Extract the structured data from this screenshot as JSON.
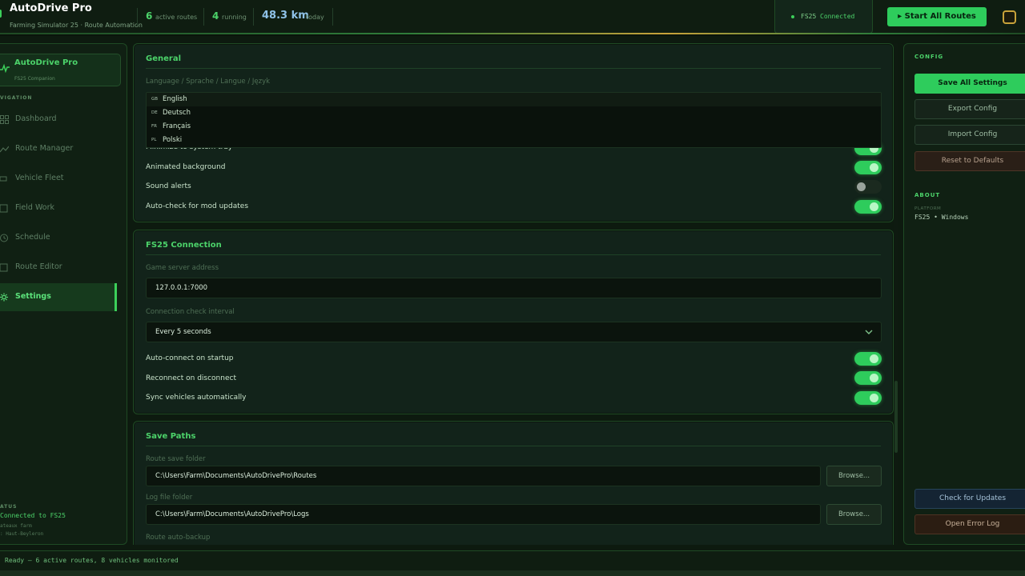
{
  "header": {
    "title": "AutoDrive Pro",
    "subtitle": "Farming Simulator 25 · Route Automation",
    "stats": [
      {
        "value": "6",
        "label": "active routes"
      },
      {
        "value": "4",
        "label": "running"
      },
      {
        "value": "48.3 km",
        "label": "today"
      }
    ],
    "connection": {
      "game": "FS25",
      "status": "Connected"
    },
    "start_button": "▸ Start All Routes"
  },
  "sidebar": {
    "brand_title": "AutoDrive Pro",
    "brand_subtitle": "FS25 Companion",
    "nav_heading": "VIGATION",
    "items": [
      {
        "label": "Dashboard",
        "icon": "grid-icon"
      },
      {
        "label": "Route Manager",
        "icon": "route-icon"
      },
      {
        "label": "Vehicle Fleet",
        "icon": "vehicle-icon"
      },
      {
        "label": "Field Work",
        "icon": "field-icon"
      },
      {
        "label": "Schedule",
        "icon": "clock-icon"
      },
      {
        "label": "Route Editor",
        "icon": "editor-icon"
      },
      {
        "label": "Settings",
        "icon": "gear-icon",
        "active": true
      }
    ],
    "status_heading": "ATUS",
    "status_connected": "Connected to FS25",
    "status_farm": "ateaux farm",
    "status_map": ": Haut-Beyleron"
  },
  "general": {
    "title": "General",
    "language_label": "Language / Sprache / Langue / Język",
    "language_options": [
      {
        "code": "GB",
        "name": "English"
      },
      {
        "code": "DE",
        "name": "Deutsch"
      },
      {
        "code": "FR",
        "name": "Français"
      },
      {
        "code": "PL",
        "name": "Polski"
      }
    ],
    "partial_row": "Minimize to system tray",
    "rows": [
      {
        "label": "Animated background",
        "on": true
      },
      {
        "label": "Sound alerts",
        "on": false
      },
      {
        "label": "Auto-check for mod updates",
        "on": true
      }
    ]
  },
  "connection": {
    "title": "FS25 Connection",
    "server_label": "Game server address",
    "server_value": "127.0.0.1:7000",
    "interval_label": "Connection check interval",
    "interval_value": "Every 5 seconds",
    "rows": [
      {
        "label": "Auto-connect on startup",
        "on": true
      },
      {
        "label": "Reconnect on disconnect",
        "on": true
      },
      {
        "label": "Sync vehicles automatically",
        "on": true
      }
    ]
  },
  "paths": {
    "title": "Save Paths",
    "route_label": "Route save folder",
    "route_value": "C:\\Users\\Farm\\Documents\\AutoDrivePro\\Routes",
    "log_label": "Log file folder",
    "log_value": "C:\\Users\\Farm\\Documents\\AutoDrivePro\\Logs",
    "browse": "Browse...",
    "backup_label": "Route auto-backup"
  },
  "right_panel": {
    "config_heading": "CONFIG",
    "save_all": "Save All Settings",
    "export": "Export Config",
    "import": "Import Config",
    "reset": "Reset to Defaults",
    "about_heading": "ABOUT",
    "platform_label": "PLATFORM",
    "platform_value": "FS25 • Windows",
    "check_updates": "Check for Updates",
    "open_log": "Open Error Log"
  },
  "footer": {
    "status": "Ready — 6 active routes, 8 vehicles monitored"
  },
  "colors": {
    "accent": "#2ecc5c",
    "accent_text": "#4cd36a",
    "background": "#0d1a0f",
    "panel": "#12231a",
    "border": "#1f4a24",
    "km_blue": "#8fc2e8",
    "user_gold": "#c8a23a"
  }
}
